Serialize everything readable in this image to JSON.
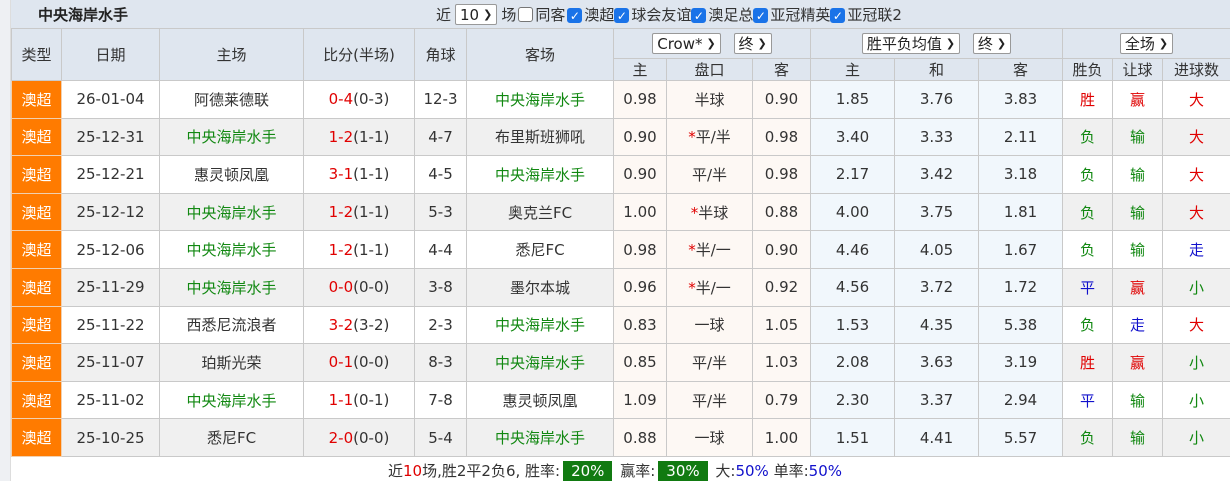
{
  "title": "中央海岸水手",
  "filters": {
    "near_label": "近",
    "count": "10",
    "match_label": "场",
    "same_host": {
      "label": "同客",
      "checked": false
    },
    "leagues": [
      {
        "label": "澳超",
        "checked": true
      },
      {
        "label": "球会友谊",
        "checked": true
      },
      {
        "label": "澳足总",
        "checked": true
      },
      {
        "label": "亚冠精英",
        "checked": true
      },
      {
        "label": "亚冠联2",
        "checked": true
      }
    ]
  },
  "header": {
    "type": "类型",
    "date": "日期",
    "home": "主场",
    "score": "比分(半场)",
    "corner": "角球",
    "away": "客场",
    "odds_company": "Crow*",
    "odds_stage": "终",
    "avg_type": "胜平负均值",
    "avg_stage": "终",
    "period": "全场",
    "sub": [
      "主",
      "盘口",
      "客",
      "主",
      "和",
      "客",
      "胜负",
      "让球",
      "进球数"
    ]
  },
  "colors": {
    "type_bg": "#ff7b00",
    "team_highlight": "#118811",
    "score": "#e00000",
    "win": "#e00000",
    "lose": "#118811",
    "draw": "#1111cc"
  },
  "rows": [
    {
      "type": "澳超",
      "date": "26-01-04",
      "home": "阿德莱德联",
      "home_hl": false,
      "ft": "0-4",
      "ht": "(0-3)",
      "corner": "12-3",
      "away": "中央海岸水手",
      "away_hl": true,
      "o_h": "0.98",
      "star": false,
      "line": "半球",
      "o_a": "0.90",
      "a_h": "1.85",
      "a_d": "3.76",
      "a_a": "3.83",
      "res": "胜",
      "res_c": "red",
      "hc": "赢",
      "hc_c": "red",
      "ou": "大",
      "ou_c": "red"
    },
    {
      "type": "澳超",
      "date": "25-12-31",
      "home": "中央海岸水手",
      "home_hl": true,
      "ft": "1-2",
      "ht": "(1-1)",
      "corner": "4-7",
      "away": "布里斯班狮吼",
      "away_hl": false,
      "o_h": "0.90",
      "star": true,
      "line": "平/半",
      "o_a": "0.98",
      "a_h": "3.40",
      "a_d": "3.33",
      "a_a": "2.11",
      "res": "负",
      "res_c": "green",
      "hc": "输",
      "hc_c": "green",
      "ou": "大",
      "ou_c": "red"
    },
    {
      "type": "澳超",
      "date": "25-12-21",
      "home": "惠灵顿凤凰",
      "home_hl": false,
      "ft": "3-1",
      "ht": "(1-1)",
      "corner": "4-5",
      "away": "中央海岸水手",
      "away_hl": true,
      "o_h": "0.90",
      "star": false,
      "line": "平/半",
      "o_a": "0.98",
      "a_h": "2.17",
      "a_d": "3.42",
      "a_a": "3.18",
      "res": "负",
      "res_c": "green",
      "hc": "输",
      "hc_c": "green",
      "ou": "大",
      "ou_c": "red"
    },
    {
      "type": "澳超",
      "date": "25-12-12",
      "home": "中央海岸水手",
      "home_hl": true,
      "ft": "1-2",
      "ht": "(1-1)",
      "corner": "5-3",
      "away": "奥克兰FC",
      "away_hl": false,
      "o_h": "1.00",
      "star": true,
      "line": "半球",
      "o_a": "0.88",
      "a_h": "4.00",
      "a_d": "3.75",
      "a_a": "1.81",
      "res": "负",
      "res_c": "green",
      "hc": "输",
      "hc_c": "green",
      "ou": "大",
      "ou_c": "red"
    },
    {
      "type": "澳超",
      "date": "25-12-06",
      "home": "中央海岸水手",
      "home_hl": true,
      "ft": "1-2",
      "ht": "(1-1)",
      "corner": "4-4",
      "away": "悉尼FC",
      "away_hl": false,
      "o_h": "0.98",
      "star": true,
      "line": "半/一",
      "o_a": "0.90",
      "a_h": "4.46",
      "a_d": "4.05",
      "a_a": "1.67",
      "res": "负",
      "res_c": "green",
      "hc": "输",
      "hc_c": "green",
      "ou": "走",
      "ou_c": "blue"
    },
    {
      "type": "澳超",
      "date": "25-11-29",
      "home": "中央海岸水手",
      "home_hl": true,
      "ft": "0-0",
      "ht": "(0-0)",
      "corner": "3-8",
      "away": "墨尔本城",
      "away_hl": false,
      "o_h": "0.96",
      "star": true,
      "line": "半/一",
      "o_a": "0.92",
      "a_h": "4.56",
      "a_d": "3.72",
      "a_a": "1.72",
      "res": "平",
      "res_c": "blue",
      "hc": "赢",
      "hc_c": "red",
      "ou": "小",
      "ou_c": "green"
    },
    {
      "type": "澳超",
      "date": "25-11-22",
      "home": "西悉尼流浪者",
      "home_hl": false,
      "ft": "3-2",
      "ht": "(3-2)",
      "corner": "2-3",
      "away": "中央海岸水手",
      "away_hl": true,
      "o_h": "0.83",
      "star": false,
      "line": "一球",
      "o_a": "1.05",
      "a_h": "1.53",
      "a_d": "4.35",
      "a_a": "5.38",
      "res": "负",
      "res_c": "green",
      "hc": "走",
      "hc_c": "blue",
      "ou": "大",
      "ou_c": "red"
    },
    {
      "type": "澳超",
      "date": "25-11-07",
      "home": "珀斯光荣",
      "home_hl": false,
      "ft": "0-1",
      "ht": "(0-0)",
      "corner": "8-3",
      "away": "中央海岸水手",
      "away_hl": true,
      "o_h": "0.85",
      "star": false,
      "line": "平/半",
      "o_a": "1.03",
      "a_h": "2.08",
      "a_d": "3.63",
      "a_a": "3.19",
      "res": "胜",
      "res_c": "red",
      "hc": "赢",
      "hc_c": "red",
      "ou": "小",
      "ou_c": "green"
    },
    {
      "type": "澳超",
      "date": "25-11-02",
      "home": "中央海岸水手",
      "home_hl": true,
      "ft": "1-1",
      "ht": "(0-1)",
      "corner": "7-8",
      "away": "惠灵顿凤凰",
      "away_hl": false,
      "o_h": "1.09",
      "star": false,
      "line": "平/半",
      "o_a": "0.79",
      "a_h": "2.30",
      "a_d": "3.37",
      "a_a": "2.94",
      "res": "平",
      "res_c": "blue",
      "hc": "输",
      "hc_c": "green",
      "ou": "小",
      "ou_c": "green"
    },
    {
      "type": "澳超",
      "date": "25-10-25",
      "home": "悉尼FC",
      "home_hl": false,
      "ft": "2-0",
      "ht": "(0-0)",
      "corner": "5-4",
      "away": "中央海岸水手",
      "away_hl": true,
      "o_h": "0.88",
      "star": false,
      "line": "一球",
      "o_a": "1.00",
      "a_h": "1.51",
      "a_d": "4.41",
      "a_a": "5.57",
      "res": "负",
      "res_c": "green",
      "hc": "输",
      "hc_c": "green",
      "ou": "小",
      "ou_c": "green"
    }
  ],
  "summary": {
    "p1": "近",
    "count": "10",
    "p2": "场,胜2平2负6, 胜率:",
    "win_rate": "20%",
    "p3": "赢率:",
    "hc_rate": "30%",
    "p4": "大:",
    "over_rate": "50%",
    "p5": "单率:",
    "odd_rate": "50%"
  }
}
